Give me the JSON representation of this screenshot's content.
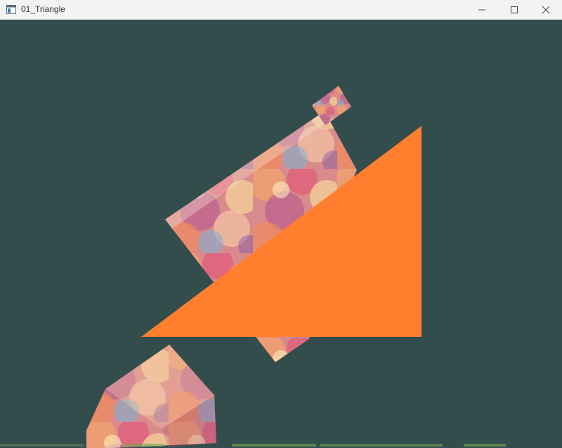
{
  "window": {
    "title": "01_Triangle",
    "icon": "app-window-icon"
  },
  "controls": {
    "minimize_icon": "minimize-icon",
    "maximize_icon": "maximize-icon",
    "close_icon": "close-icon"
  },
  "colors": {
    "clear_color": "#334d4d",
    "triangle": "#ff7f2e",
    "titlebar_bg": "#f3f3f3"
  },
  "scene": {
    "objects": [
      "orange-triangle",
      "textured-rectangle",
      "small-textured-square",
      "textured-cube"
    ]
  }
}
